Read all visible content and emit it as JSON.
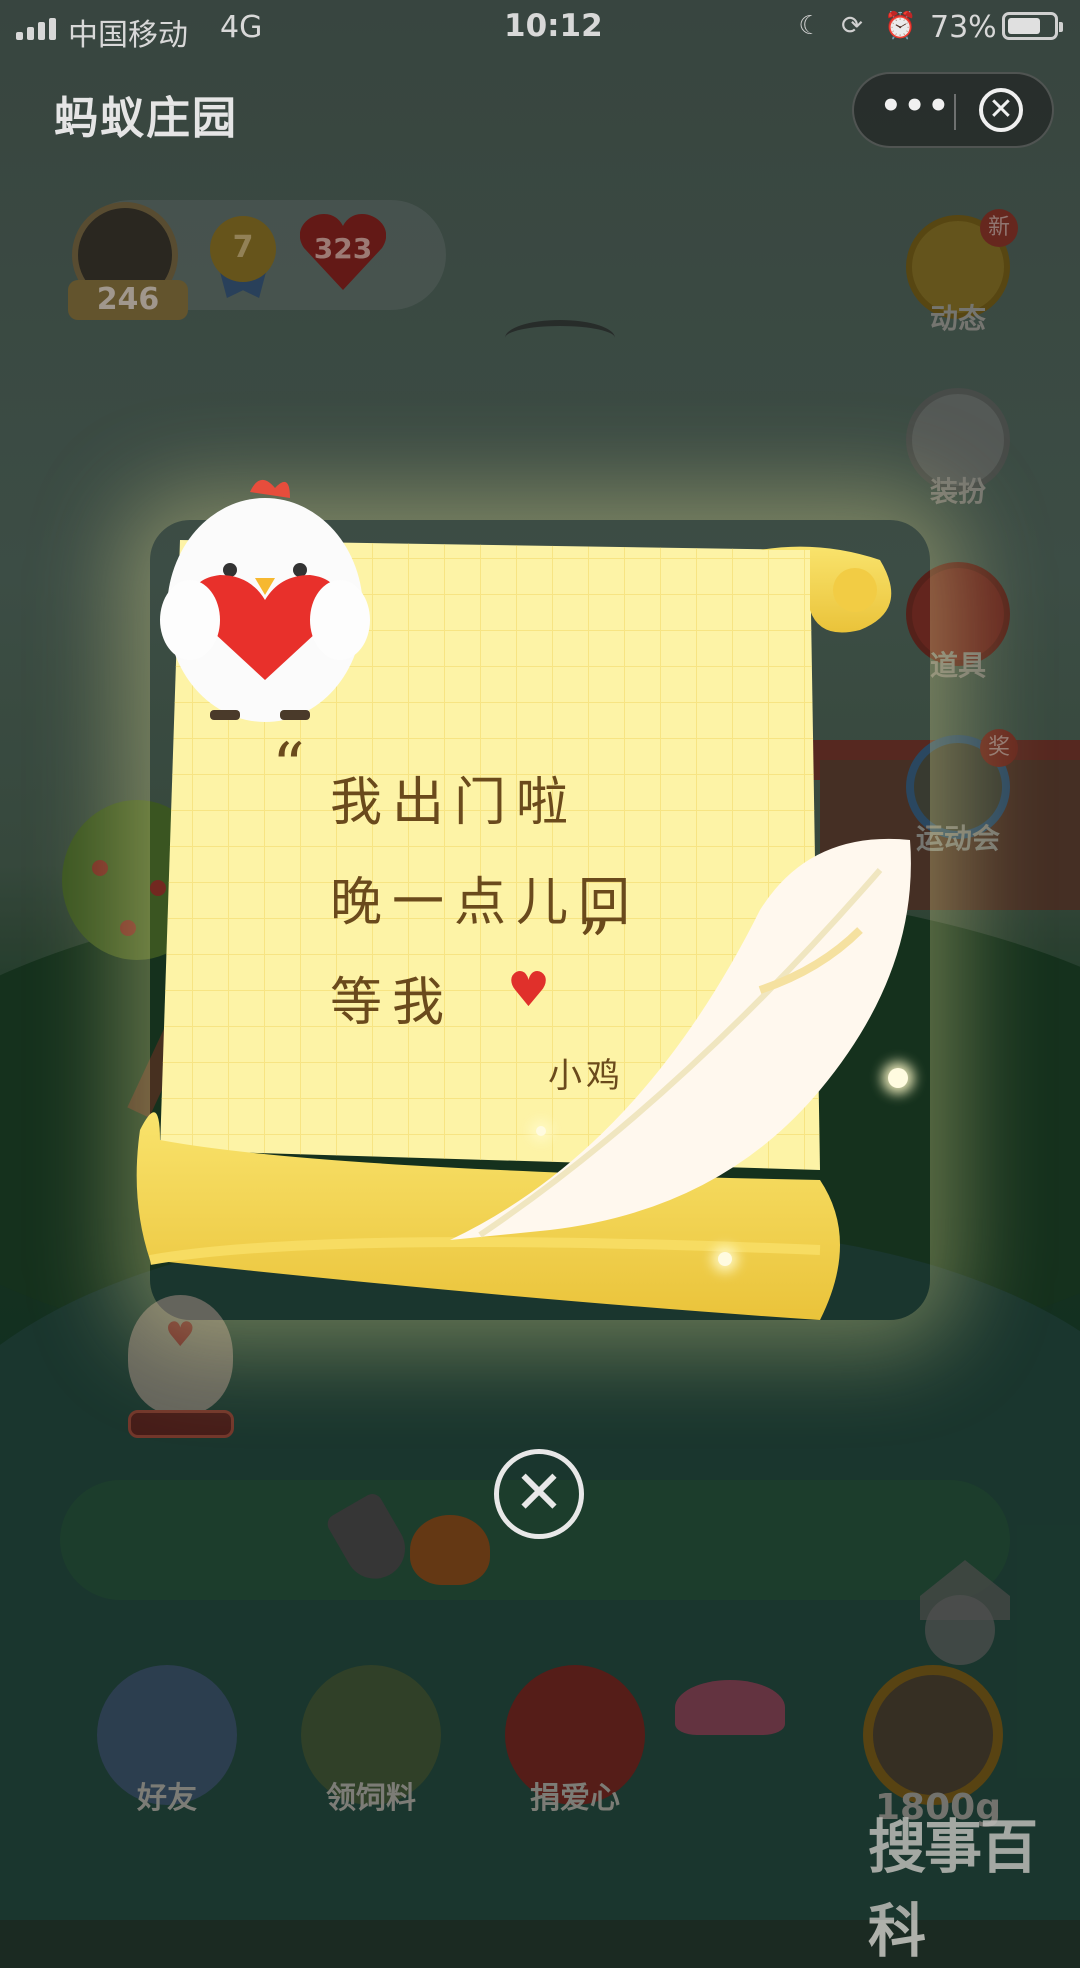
{
  "status_bar": {
    "carrier": "中国移动",
    "network": "4G",
    "time": "10:12",
    "battery_percent": "73%",
    "battery_level": 0.73
  },
  "header": {
    "title": "蚂蚁庄园",
    "more_icon": "more-dots-icon",
    "close_icon": "close-circle-icon"
  },
  "stats": {
    "avatar_count": "246",
    "medal_level": "7",
    "love_count": "323"
  },
  "side_menu": {
    "items": [
      {
        "label": "动态",
        "badge": "新",
        "icon": "mailbox-icon"
      },
      {
        "label": "装扮",
        "icon": "dressup-icon"
      },
      {
        "label": "道具",
        "icon": "star-icon"
      },
      {
        "label": "运动会",
        "badge": "奖",
        "icon": "medal-icon",
        "medal": "1"
      }
    ]
  },
  "letter": {
    "lines": [
      "我出门啦",
      "晚一点儿回",
      "等我"
    ],
    "open_quote": "“",
    "close_quote": "”",
    "signature": "小鸡",
    "heart_icon": "heart-icon"
  },
  "bottom_nav": {
    "items": [
      {
        "label": "好友",
        "icon": "friends-icon"
      },
      {
        "label": "领饲料",
        "icon": "feed-bag-icon"
      },
      {
        "label": "捐爱心",
        "icon": "heart-icon"
      },
      {
        "label": "",
        "icon": "food-bag-icon"
      }
    ],
    "feed_amount": "1800g"
  },
  "watermark": "搜事百科",
  "colors": {
    "paper": "#fdf3a6",
    "paper_edge": "#f6d65a",
    "ink": "#6a4a1c",
    "heart": "#e0302b"
  }
}
